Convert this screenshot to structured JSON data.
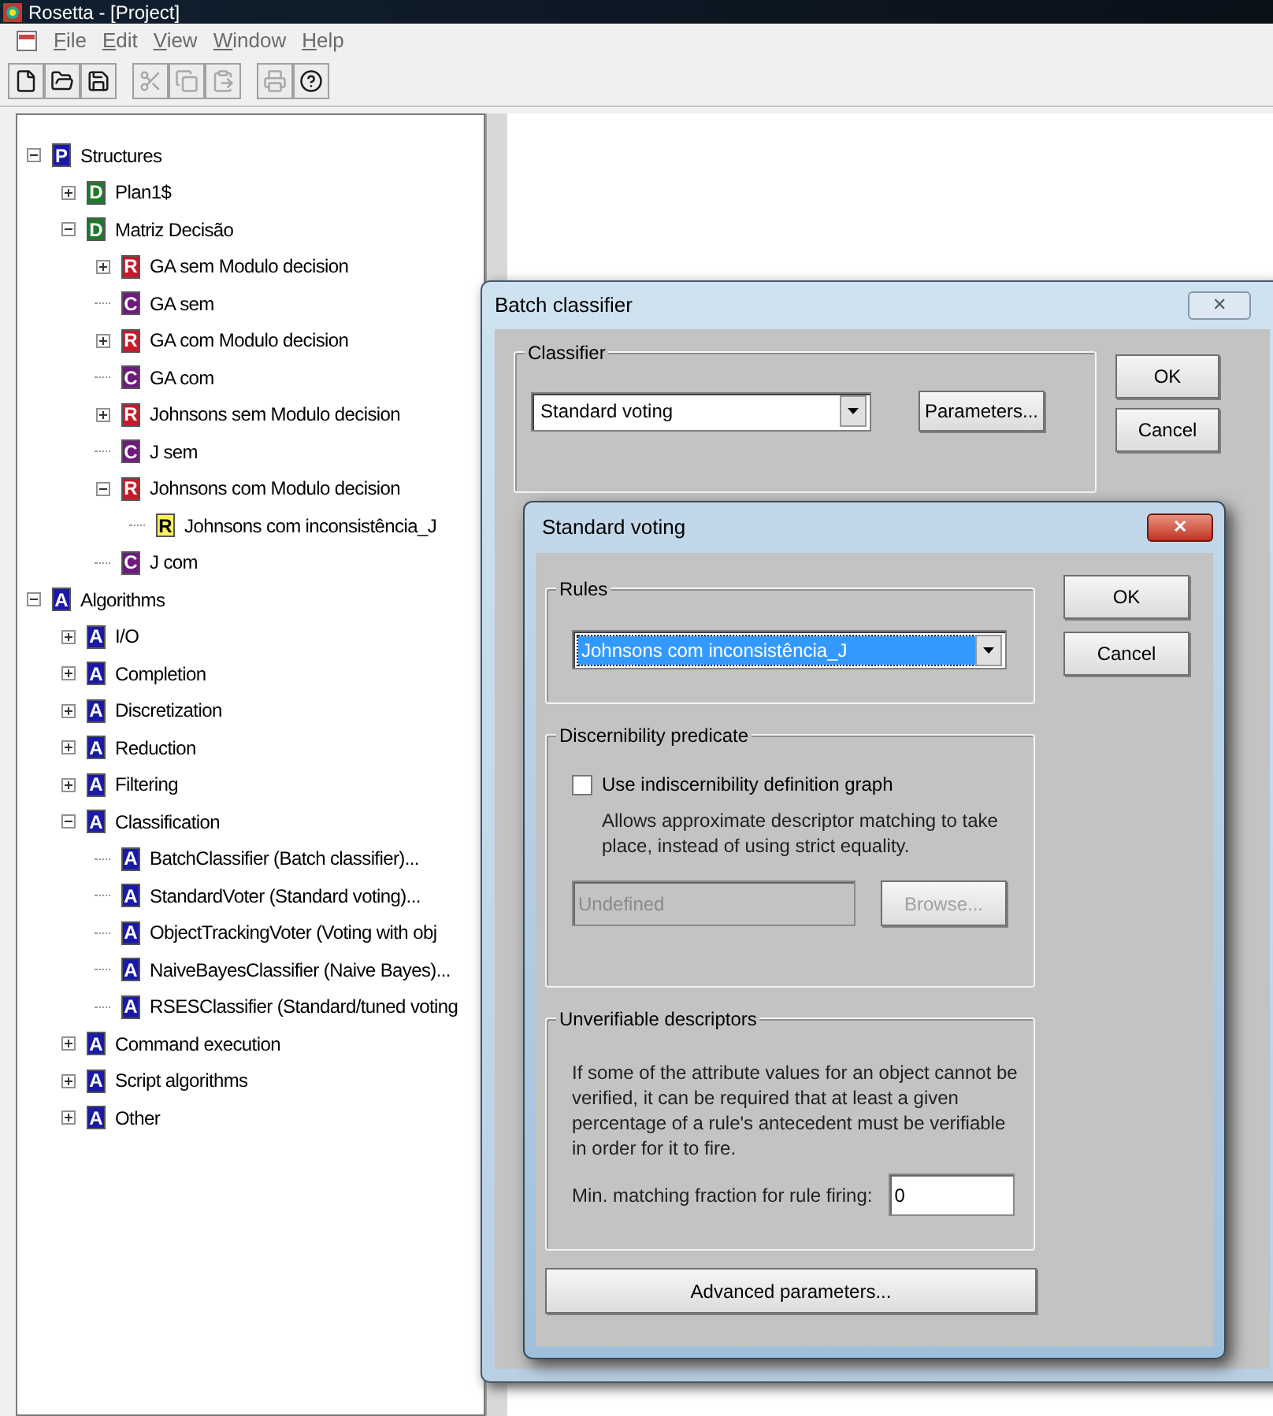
{
  "window": {
    "title": "Rosetta - [Project]"
  },
  "menu": [
    "File",
    "Edit",
    "View",
    "Window",
    "Help"
  ],
  "toolbar": [
    {
      "disabled": false
    },
    {
      "disabled": false
    },
    {
      "disabled": false
    },
    {
      "disabled": true
    },
    {
      "disabled": true
    },
    {
      "disabled": true
    },
    {
      "disabled": true
    },
    {
      "disabled": false
    }
  ],
  "tree": [
    {
      "badge": "P",
      "color": "#1a1aa8",
      "label": "Structures",
      "expanded": true,
      "children": [
        {
          "badge": "D",
          "color": "#1c7a2a",
          "label": "Plan1$",
          "expanded": false
        },
        {
          "badge": "D",
          "color": "#1c7a2a",
          "label": "Matriz Decisão",
          "expanded": true,
          "children": [
            {
              "badge": "R",
              "color": "#c8182a",
              "label": "GA sem Modulo decision",
              "expanded": false
            },
            {
              "badge": "C",
              "color": "#6e1a7e",
              "label": "GA sem"
            },
            {
              "badge": "R",
              "color": "#c8182a",
              "label": "GA com Modulo decision",
              "expanded": false
            },
            {
              "badge": "C",
              "color": "#6e1a7e",
              "label": "GA com"
            },
            {
              "badge": "R",
              "color": "#c8182a",
              "label": "Johnsons sem Modulo decision",
              "expanded": false
            },
            {
              "badge": "C",
              "color": "#6e1a7e",
              "label": "J sem"
            },
            {
              "badge": "R",
              "color": "#c8182a",
              "label": "Johnsons com Modulo decision",
              "expanded": true,
              "children": [
                {
                  "badge": "R",
                  "color": "#f8f060",
                  "label": "Johnsons com inconsistência_J"
                }
              ]
            },
            {
              "badge": "C",
              "color": "#6e1a7e",
              "label": "J com"
            }
          ]
        }
      ]
    },
    {
      "badge": "A",
      "color": "#1a1aa8",
      "label": "Algorithms",
      "expanded": true,
      "children": [
        {
          "badge": "A",
          "color": "#1a1aa8",
          "label": "I/O",
          "expanded": false
        },
        {
          "badge": "A",
          "color": "#1a1aa8",
          "label": "Completion",
          "expanded": false
        },
        {
          "badge": "A",
          "color": "#1a1aa8",
          "label": "Discretization",
          "expanded": false
        },
        {
          "badge": "A",
          "color": "#1a1aa8",
          "label": "Reduction",
          "expanded": false
        },
        {
          "badge": "A",
          "color": "#1a1aa8",
          "label": "Filtering",
          "expanded": false
        },
        {
          "badge": "A",
          "color": "#1a1aa8",
          "label": "Classification",
          "expanded": true,
          "children": [
            {
              "badge": "A",
              "color": "#1a1aa8",
              "label": "BatchClassifier (Batch classifier)..."
            },
            {
              "badge": "A",
              "color": "#1a1aa8",
              "label": "StandardVoter (Standard voting)..."
            },
            {
              "badge": "A",
              "color": "#1a1aa8",
              "label": "ObjectTrackingVoter (Voting with obj"
            },
            {
              "badge": "A",
              "color": "#1a1aa8",
              "label": "NaiveBayesClassifier (Naive Bayes)..."
            },
            {
              "badge": "A",
              "color": "#1a1aa8",
              "label": "RSESClassifier (Standard/tuned voting"
            }
          ]
        },
        {
          "badge": "A",
          "color": "#1a1aa8",
          "label": "Command execution",
          "expanded": false
        },
        {
          "badge": "A",
          "color": "#1a1aa8",
          "label": "Script algorithms",
          "expanded": false
        },
        {
          "badge": "A",
          "color": "#1a1aa8",
          "label": "Other",
          "expanded": false
        }
      ]
    }
  ],
  "batch_dialog": {
    "title": "Batch classifier",
    "close": "✕",
    "group": "Classifier",
    "classifier": "Standard voting",
    "parameters_button": "Parameters...",
    "ok": "OK",
    "cancel": "Cancel"
  },
  "voting_dialog": {
    "title": "Standard voting",
    "close": "✕",
    "ok": "OK",
    "cancel": "Cancel",
    "rules": {
      "title": "Rules",
      "value": "Johnsons com inconsistência_J"
    },
    "discernibility": {
      "title": "Discernibility predicate",
      "checkbox": {
        "label": "Use indiscernibility definition graph",
        "checked": false
      },
      "description": "Allows approximate descriptor matching to take place, instead of using strict equality.",
      "field": {
        "value": "Undefined",
        "disabled": true
      },
      "browse": {
        "label": "Browse...",
        "disabled": true
      }
    },
    "unverifiable": {
      "title": "Unverifiable descriptors",
      "description": "If some of the attribute values for an object cannot be verified, it can be required that at least a given percentage of a rule's antecedent must be verifiable in order for it to fire.",
      "field_label": "Min. matching fraction for rule firing:",
      "value": "0"
    },
    "advanced_button": "Advanced parameters..."
  }
}
